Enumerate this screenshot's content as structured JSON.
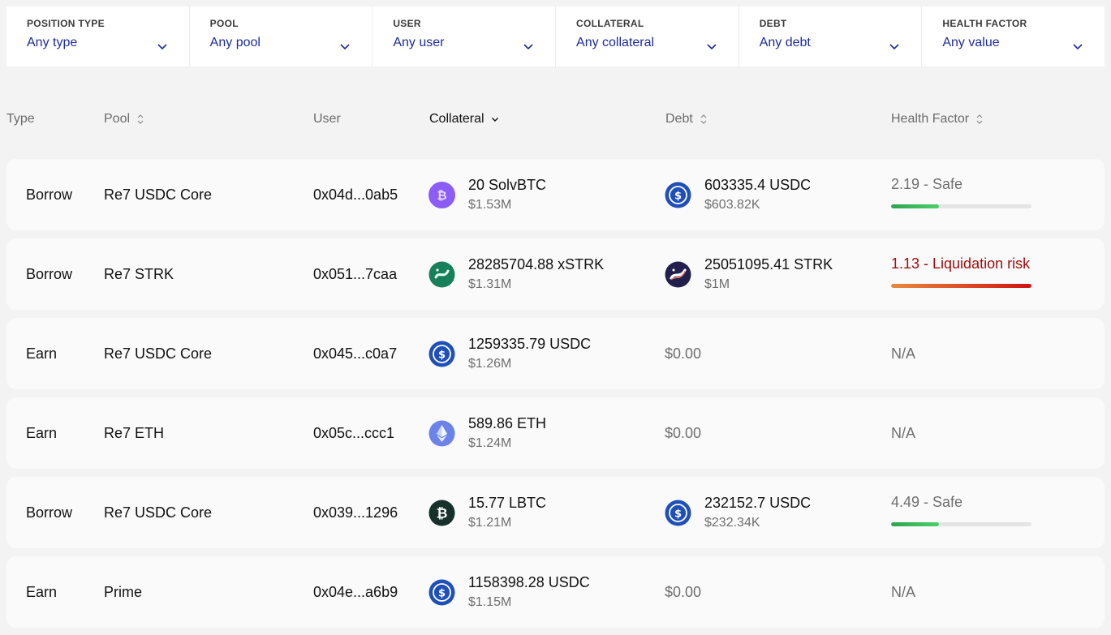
{
  "filters": [
    {
      "label": "POSITION TYPE",
      "value": "Any type"
    },
    {
      "label": "POOL",
      "value": "Any pool"
    },
    {
      "label": "USER",
      "value": "Any user"
    },
    {
      "label": "COLLATERAL",
      "value": "Any collateral"
    },
    {
      "label": "DEBT",
      "value": "Any debt"
    },
    {
      "label": "HEALTH FACTOR",
      "value": "Any value"
    }
  ],
  "columns": {
    "type": "Type",
    "pool": "Pool",
    "user": "User",
    "collateral": "Collateral",
    "debt": "Debt",
    "health": "Health Factor"
  },
  "rows": [
    {
      "type": "Borrow",
      "pool": "Re7 USDC Core",
      "user": "0x04d...0ab5",
      "collateral": {
        "amount": "20 SolvBTC",
        "usd": "$1.53M",
        "icon": "solvbtc-icon"
      },
      "debt": {
        "amount": "603335.4 USDC",
        "usd": "$603.82K",
        "icon": "usdc-icon"
      },
      "health": {
        "text": "2.19 - Safe",
        "level": 0.34,
        "status": "safe"
      }
    },
    {
      "type": "Borrow",
      "pool": "Re7 STRK",
      "user": "0x051...7caa",
      "collateral": {
        "amount": "28285704.88 xSTRK",
        "usd": "$1.31M",
        "icon": "xstrk-icon"
      },
      "debt": {
        "amount": "25051095.41 STRK",
        "usd": "$1M",
        "icon": "strk-icon"
      },
      "health": {
        "text": "1.13 - Liquidation risk",
        "level": 1.0,
        "status": "risk"
      }
    },
    {
      "type": "Earn",
      "pool": "Re7 USDC Core",
      "user": "0x045...c0a7",
      "collateral": {
        "amount": "1259335.79 USDC",
        "usd": "$1.26M",
        "icon": "usdc-icon"
      },
      "debt": {
        "value": "$0.00"
      },
      "health": {
        "text": "N/A"
      }
    },
    {
      "type": "Earn",
      "pool": "Re7 ETH",
      "user": "0x05c...ccc1",
      "collateral": {
        "amount": "589.86 ETH",
        "usd": "$1.24M",
        "icon": "eth-icon"
      },
      "debt": {
        "value": "$0.00"
      },
      "health": {
        "text": "N/A"
      }
    },
    {
      "type": "Borrow",
      "pool": "Re7 USDC Core",
      "user": "0x039...1296",
      "collateral": {
        "amount": "15.77 LBTC",
        "usd": "$1.21M",
        "icon": "lbtc-icon"
      },
      "debt": {
        "amount": "232152.7 USDC",
        "usd": "$232.34K",
        "icon": "usdc-icon"
      },
      "health": {
        "text": "4.49 - Safe",
        "level": 0.34,
        "status": "safe"
      }
    },
    {
      "type": "Earn",
      "pool": "Prime",
      "user": "0x04e...a6b9",
      "collateral": {
        "amount": "1158398.28 USDC",
        "usd": "$1.15M",
        "icon": "usdc-icon"
      },
      "debt": {
        "value": "$0.00"
      },
      "health": {
        "text": "N/A"
      }
    }
  ],
  "colors": {
    "filter_value": "#1d2a9e",
    "safe_text": "#6f6f6f",
    "risk_text": "#a00d0d",
    "safe_bar": "#3cc462",
    "risk_bar_start": "#e98a3d",
    "risk_bar_end": "#d11212"
  }
}
